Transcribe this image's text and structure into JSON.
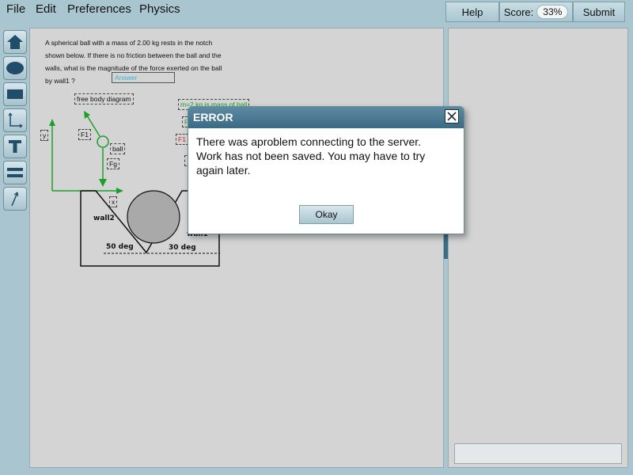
{
  "menu": [
    "File",
    "Edit",
    "Preferences",
    "Physics"
  ],
  "toolbar": {
    "help_label": "Help",
    "score_label": "Score:",
    "score_value": "33%",
    "submit_label": "Submit"
  },
  "tools": [
    "home-tool-icon",
    "ellipse-tool-icon",
    "rectangle-tool-icon",
    "axes-tool-icon",
    "text-tool-icon",
    "equation-tool-icon",
    "vector-tool-icon"
  ],
  "problem": {
    "text": "A spherical ball with a mass of 2.00 kg rests in the notch shown below.  If there is no friction between the ball and the walls, what is the magnitude of the force exerted on the ball by wall1 ?",
    "answer_placeholder": "Answer"
  },
  "diagram": {
    "fbd_label": "free body diagram",
    "y_label": "y",
    "x_label": "x",
    "f1_label": "F1",
    "fg_label": "Fg",
    "ball_label": "ball",
    "mass_note": "m=2 kg is mass of ball",
    "f_green_label": "F",
    "f1_red_label": "F1",
    "wall2_label": "wall2",
    "wall1_label": "wall1",
    "angle_left": "50 deg",
    "angle_right": "30 deg"
  },
  "dialog": {
    "title": "ERROR",
    "message": "There was aproblem connecting to the server. Work has not been saved. You may have to try again later.",
    "ok_label": "Okay"
  },
  "colors": {
    "accent": "#3b6a85",
    "vector": "#1aa02a",
    "error_label": "#d42020",
    "answer_text": "#2fb8d8"
  }
}
